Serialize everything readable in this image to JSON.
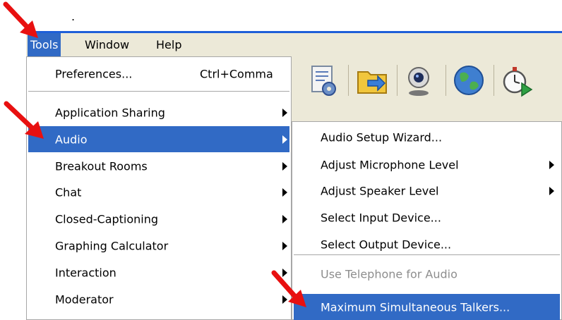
{
  "top_dot": ".",
  "menubar": {
    "items": [
      {
        "label": "Tools"
      },
      {
        "label": "Window"
      },
      {
        "label": "Help"
      }
    ]
  },
  "tools_menu": {
    "preferences": {
      "label": "Preferences...",
      "shortcut": "Ctrl+Comma"
    },
    "items": [
      {
        "label": "Application Sharing"
      },
      {
        "label": "Audio"
      },
      {
        "label": "Breakout Rooms"
      },
      {
        "label": "Chat"
      },
      {
        "label": "Closed-Captioning"
      },
      {
        "label": "Graphing Calculator"
      },
      {
        "label": "Interaction"
      },
      {
        "label": "Moderator"
      }
    ]
  },
  "audio_submenu": {
    "items": [
      {
        "label": "Audio Setup Wizard..."
      },
      {
        "label": "Adjust Microphone Level"
      },
      {
        "label": "Adjust Speaker Level"
      },
      {
        "label": "Select Input Device..."
      },
      {
        "label": "Select Output Device..."
      },
      {
        "label": "Use Telephone for Audio"
      },
      {
        "label": "Maximum Simultaneous Talkers..."
      }
    ]
  },
  "toolbar": {
    "icons": [
      "document-gear-icon",
      "folder-arrow-icon",
      "webcam-icon",
      "globe-icon",
      "stopwatch-play-icon"
    ]
  },
  "colors": {
    "selection": "#316ac5",
    "menu_bg": "#ffffff",
    "chrome": "#ece9d8",
    "annotation_arrow": "#e81010"
  }
}
